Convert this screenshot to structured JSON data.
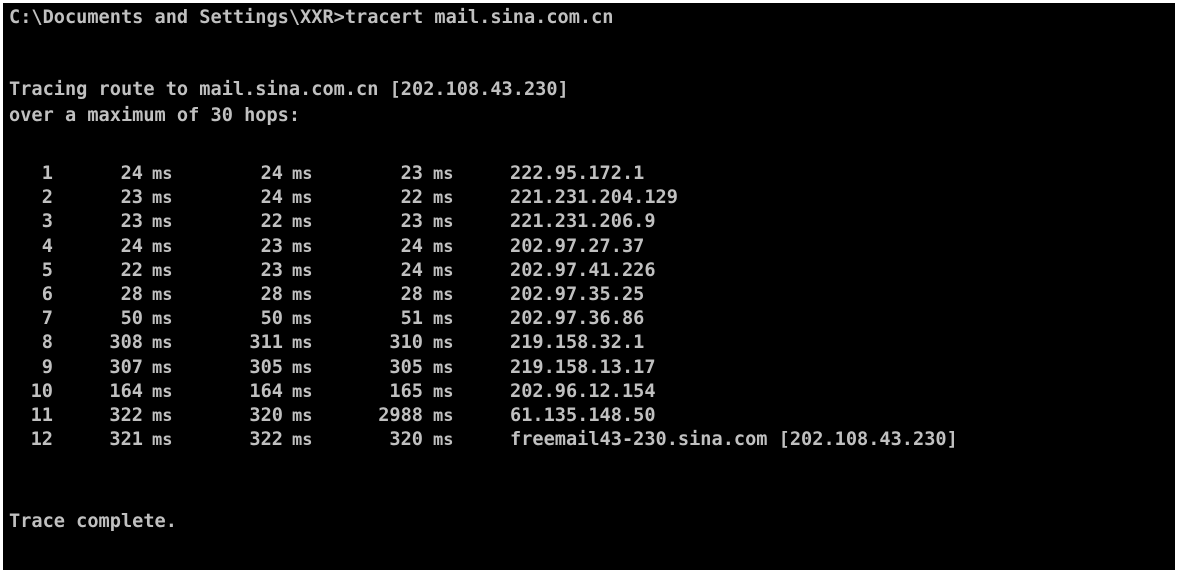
{
  "console": {
    "command_line": "C:\\Documents and Settings\\XXR>tracert mail.sina.com.cn",
    "tracing_line": "Tracing route to mail.sina.com.cn [202.108.43.230]",
    "max_hops_line": "over a maximum of 30 hops:",
    "unit": "ms",
    "hops": [
      {
        "num": "1",
        "t1": "24",
        "t2": "24",
        "t3": "23",
        "host": "222.95.172.1"
      },
      {
        "num": "2",
        "t1": "23",
        "t2": "24",
        "t3": "22",
        "host": "221.231.204.129"
      },
      {
        "num": "3",
        "t1": "23",
        "t2": "22",
        "t3": "23",
        "host": "221.231.206.9"
      },
      {
        "num": "4",
        "t1": "24",
        "t2": "23",
        "t3": "24",
        "host": "202.97.27.37"
      },
      {
        "num": "5",
        "t1": "22",
        "t2": "23",
        "t3": "24",
        "host": "202.97.41.226"
      },
      {
        "num": "6",
        "t1": "28",
        "t2": "28",
        "t3": "28",
        "host": "202.97.35.25"
      },
      {
        "num": "7",
        "t1": "50",
        "t2": "50",
        "t3": "51",
        "host": "202.97.36.86"
      },
      {
        "num": "8",
        "t1": "308",
        "t2": "311",
        "t3": "310",
        "host": "219.158.32.1"
      },
      {
        "num": "9",
        "t1": "307",
        "t2": "305",
        "t3": "305",
        "host": "219.158.13.17"
      },
      {
        "num": "10",
        "t1": "164",
        "t2": "164",
        "t3": "165",
        "host": "202.96.12.154"
      },
      {
        "num": "11",
        "t1": "322",
        "t2": "320",
        "t3": "2988",
        "host": "61.135.148.50"
      },
      {
        "num": "12",
        "t1": "321",
        "t2": "322",
        "t3": "320",
        "host": "freemail43-230.sina.com [202.108.43.230]"
      }
    ],
    "complete_line": "Trace complete.",
    "colors": {
      "background": "#000000",
      "text": "#c0c0c0",
      "frame": "#ffffff"
    }
  }
}
